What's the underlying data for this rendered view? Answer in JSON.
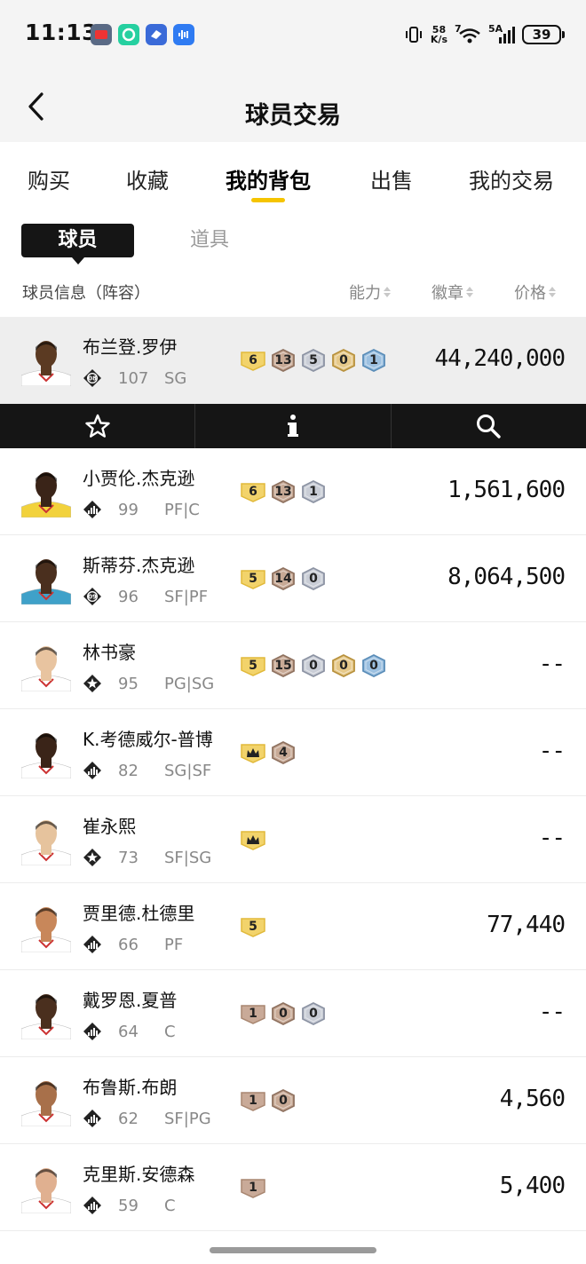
{
  "status_bar": {
    "time": "11:13",
    "net_speed_value": "58",
    "net_speed_unit": "K/s",
    "wifi_label": "7",
    "signal_label": "5A",
    "battery": "39"
  },
  "header": {
    "title": "球员交易"
  },
  "tabs": [
    {
      "label": "购买"
    },
    {
      "label": "收藏"
    },
    {
      "label": "我的背包",
      "active": true
    },
    {
      "label": "出售"
    },
    {
      "label": "我的交易"
    }
  ],
  "subtabs": {
    "active": "球员",
    "other": "道具"
  },
  "columns": {
    "info": "球员信息（阵容）",
    "ability": "能力",
    "badges": "徽章",
    "price": "价格"
  },
  "colors": {
    "accent": "#f5c400",
    "dark": "#151515"
  },
  "players": [
    {
      "name": "布兰登.罗伊",
      "tier": "08",
      "rating": "107",
      "position": "SG",
      "badges": [
        {
          "v": "6",
          "t": "gold-flat"
        },
        {
          "v": "13",
          "t": "bronze"
        },
        {
          "v": "5",
          "t": "silver"
        },
        {
          "v": "0",
          "t": "gold"
        },
        {
          "v": "1",
          "t": "blue"
        }
      ],
      "price": "44,240,000",
      "selected": true,
      "jersey": "#ffffff",
      "skin": "#5b3a22"
    },
    {
      "name": "小贾伦.杰克逊",
      "tier": "bars",
      "rating": "99",
      "position": "PF|C",
      "badges": [
        {
          "v": "6",
          "t": "gold-flat"
        },
        {
          "v": "13",
          "t": "bronze"
        },
        {
          "v": "1",
          "t": "silver"
        }
      ],
      "price": "1,561,600",
      "jersey": "#f2d23c",
      "skin": "#3a2418"
    },
    {
      "name": "斯蒂芬.杰克逊",
      "tier": "09",
      "rating": "96",
      "position": "SF|PF",
      "badges": [
        {
          "v": "5",
          "t": "gold-flat"
        },
        {
          "v": "14",
          "t": "bronze"
        },
        {
          "v": "0",
          "t": "silver"
        }
      ],
      "price": "8,064,500",
      "jersey": "#3fa1c9",
      "skin": "#4a2f1e"
    },
    {
      "name": "林书豪",
      "tier": "star",
      "rating": "95",
      "position": "PG|SG",
      "badges": [
        {
          "v": "5",
          "t": "gold-flat"
        },
        {
          "v": "15",
          "t": "bronze"
        },
        {
          "v": "0",
          "t": "silver"
        },
        {
          "v": "0",
          "t": "gold"
        },
        {
          "v": "0",
          "t": "blue"
        }
      ],
      "price": "--",
      "jersey": "#ffffff",
      "skin": "#e8c4a0"
    },
    {
      "name": "K.考德威尔-普博",
      "tier": "bars",
      "rating": "82",
      "position": "SG|SF",
      "badges": [
        {
          "v": "crown",
          "t": "gold-flat"
        },
        {
          "v": "4",
          "t": "bronze"
        }
      ],
      "price": "--",
      "jersey": "#ffffff",
      "skin": "#3a2418"
    },
    {
      "name": "崔永熙",
      "tier": "star",
      "rating": "73",
      "position": "SF|SG",
      "badges": [
        {
          "v": "crown",
          "t": "gold-flat"
        }
      ],
      "price": "--",
      "jersey": "#ffffff",
      "skin": "#e6c39d"
    },
    {
      "name": "贾里德.杜德里",
      "tier": "bars",
      "rating": "66",
      "position": "PF",
      "badges": [
        {
          "v": "5",
          "t": "gold-flat"
        }
      ],
      "price": "77,440",
      "jersey": "#ffffff",
      "skin": "#c8875a"
    },
    {
      "name": "戴罗恩.夏普",
      "tier": "bars",
      "rating": "64",
      "position": "C",
      "badges": [
        {
          "v": "1",
          "t": "bronze-flat"
        },
        {
          "v": "0",
          "t": "bronze"
        },
        {
          "v": "0",
          "t": "silver"
        }
      ],
      "price": "--",
      "jersey": "#ffffff",
      "skin": "#4a2f1e"
    },
    {
      "name": "布鲁斯.布朗",
      "tier": "bars",
      "rating": "62",
      "position": "SF|PG",
      "badges": [
        {
          "v": "1",
          "t": "bronze-flat"
        },
        {
          "v": "0",
          "t": "bronze"
        }
      ],
      "price": "4,560",
      "jersey": "#ffffff",
      "skin": "#a8704a"
    },
    {
      "name": "克里斯.安德森",
      "tier": "bars",
      "rating": "59",
      "position": "C",
      "badges": [
        {
          "v": "1",
          "t": "bronze-flat"
        }
      ],
      "price": "5,400",
      "jersey": "#ffffff",
      "skin": "#e0b090"
    }
  ],
  "actions": [
    {
      "icon": "star-icon"
    },
    {
      "icon": "info-icon"
    },
    {
      "icon": "search-icon"
    }
  ]
}
